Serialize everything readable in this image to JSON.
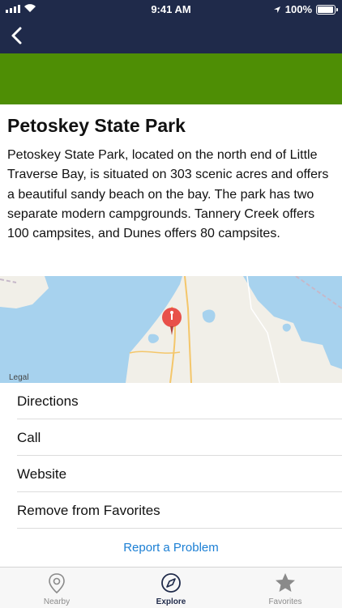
{
  "status_bar": {
    "time": "9:41 AM",
    "battery": "100%"
  },
  "colors": {
    "nav_background": "#1f2a4a",
    "hero_color": "#4e8e05",
    "link_color": "#1b7fd4"
  },
  "nav": {
    "back_icon": "chevron-left-icon"
  },
  "park": {
    "name": "Petoskey State Park",
    "description": "Petoskey State Park, located on the north end of Little Traverse Bay, is situated on 303 scenic acres and offers a beautiful sandy beach on the bay. The park has two separate modern campgrounds. Tannery Creek offers 100 campsites, and Dunes offers 80 campsites."
  },
  "map": {
    "legal_label": "Legal",
    "pin_icon": "map-pin-icon"
  },
  "actions": [
    {
      "label": "Directions"
    },
    {
      "label": "Call"
    },
    {
      "label": "Website"
    },
    {
      "label": "Remove from Favorites"
    }
  ],
  "report_label": "Report a Problem",
  "tabs": [
    {
      "label": "Nearby",
      "icon": "location-pin-icon",
      "active": false
    },
    {
      "label": "Explore",
      "icon": "compass-icon",
      "active": true
    },
    {
      "label": "Favorites",
      "icon": "star-icon",
      "active": false
    }
  ]
}
